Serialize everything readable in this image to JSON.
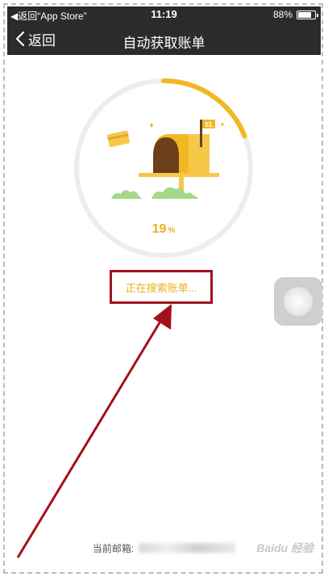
{
  "status_bar": {
    "back_app": "◀返回“App Store”",
    "time": "11:19",
    "battery": "88%",
    "battery_level": 0.88
  },
  "nav": {
    "back_label": "返回",
    "title": "自动获取账单"
  },
  "progress": {
    "value": "19",
    "unit": "%",
    "fraction": 0.19,
    "flag_number": "51",
    "status_text": "正在搜索账单..."
  },
  "footer": {
    "email_label": "当前邮箱:",
    "watermark": "Baidu 经验"
  },
  "colors": {
    "accent": "#e8b21f",
    "ring_track": "#ececf1",
    "annotation": "#a3121a",
    "bar": "#2b2b2b"
  }
}
